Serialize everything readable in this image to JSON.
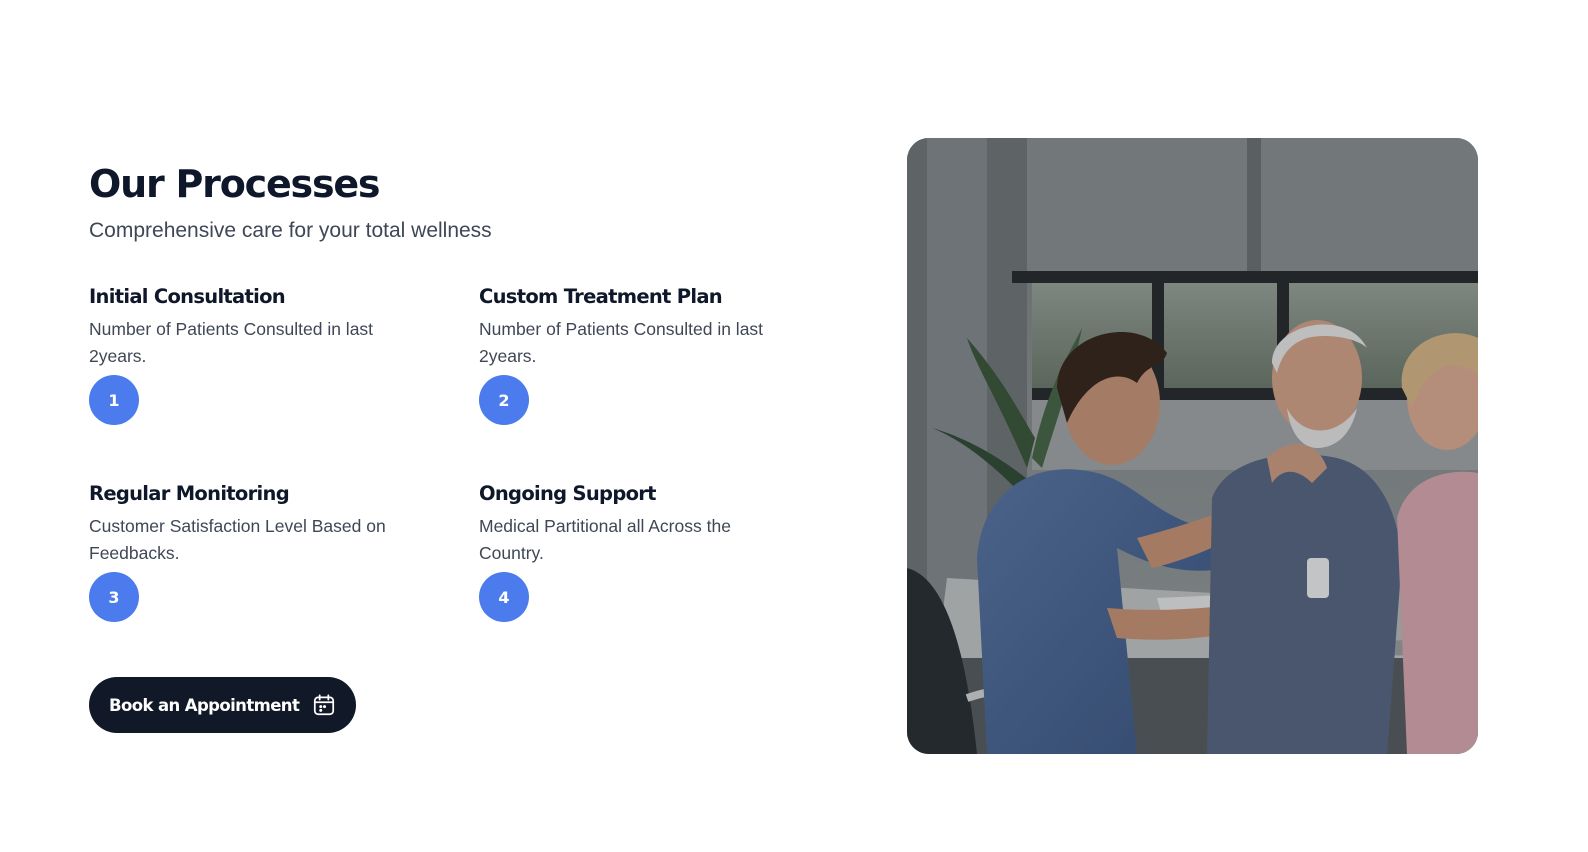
{
  "section": {
    "title": "Our Processes",
    "subtitle": "Comprehensive care for your total wellness"
  },
  "steps": [
    {
      "number": "1",
      "title": "Initial Consultation",
      "description": "Number of Patients Consulted in last 2years."
    },
    {
      "number": "2",
      "title": "Custom Treatment Plan",
      "description": "Number of Patients Consulted in last 2years."
    },
    {
      "number": "3",
      "title": "Regular Monitoring",
      "description": "Customer Satisfaction Level Based on Feedbacks."
    },
    {
      "number": "4",
      "title": "Ongoing Support",
      "description": "Medical Partitional all Across the Country."
    }
  ],
  "cta": {
    "label": "Book an Appointment",
    "icon": "calendar-icon"
  },
  "image": {
    "subject": "doctor-consulting-patients-photo"
  },
  "colors": {
    "accent": "#4b7bec",
    "dark": "#111827",
    "text": "#0f172a",
    "muted": "#3f4756"
  }
}
